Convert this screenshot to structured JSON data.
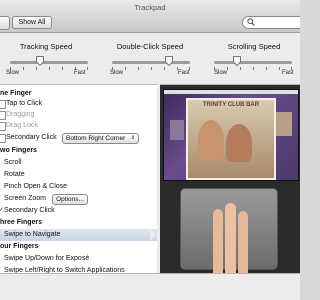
{
  "window": {
    "title": "Trackpad"
  },
  "toolbar": {
    "show_all_label": "Show All"
  },
  "sliders": [
    {
      "label": "Tracking Speed",
      "min_label": "Slow",
      "max_label": "Fast",
      "value": 0.35
    },
    {
      "label": "Double-Click Speed",
      "min_label": "Slow",
      "max_label": "Fast",
      "value": 0.6
    },
    {
      "label": "Scrolling Speed",
      "min_label": "Slow",
      "max_label": "Fast",
      "value": 0.3
    }
  ],
  "one_finger": {
    "header": "ne Finger",
    "tap_to_click": "Tap to Click",
    "dragging": "Dragging",
    "drag_lock": "Drag Lock",
    "secondary_click": "Secondary Click",
    "secondary_click_option": "Bottom Right Corner"
  },
  "two_fingers": {
    "header": "wo Fingers",
    "scroll": "Scroll",
    "rotate": "Rotate",
    "pinch": "Pinch Open & Close",
    "screen_zoom": "Screen Zoom",
    "options_button": "Options...",
    "secondary_click": "Secondary Click"
  },
  "three_fingers": {
    "header": "hree Fingers",
    "swipe_to_navigate": "Swipe to Navigate"
  },
  "four_fingers": {
    "header": "our Fingers",
    "swipe_updown": "Swipe Up/Down for Exposé",
    "swipe_leftright": "Swipe Left/Right to Switch Applications"
  },
  "preview": {
    "photo_caption": "TRINITY CLUB BAR"
  },
  "colors": {
    "selection": "#c9d3e3",
    "window_bg": "#ececec"
  }
}
